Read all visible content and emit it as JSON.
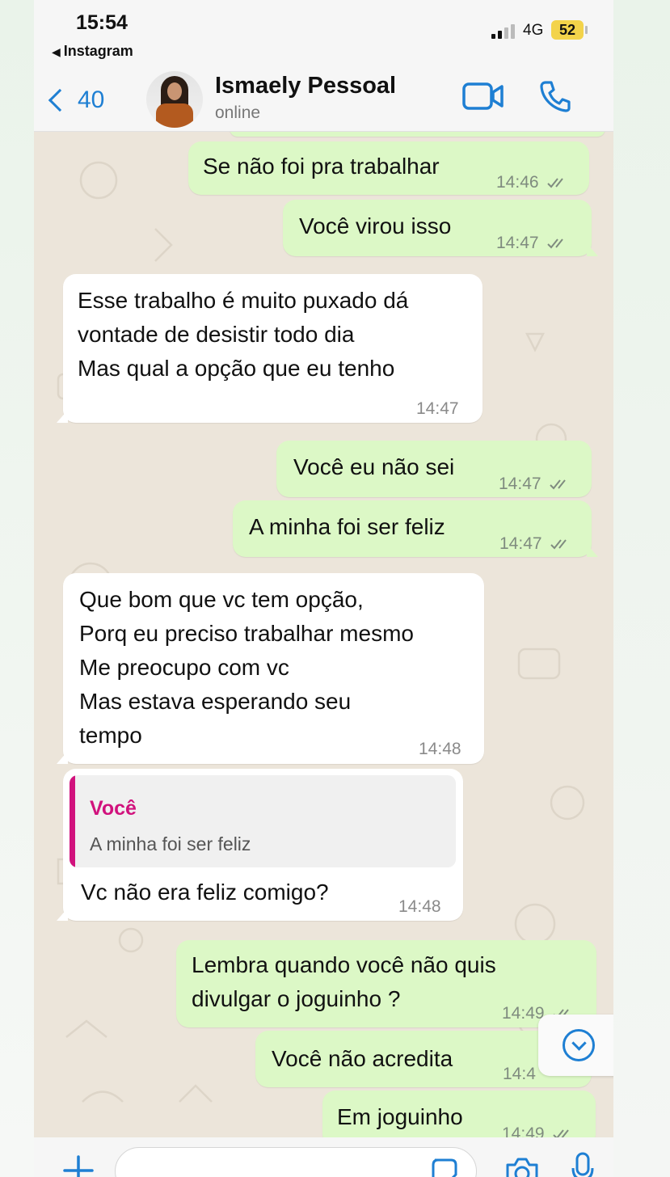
{
  "status_bar": {
    "time": "15:54",
    "back_app": "Instagram",
    "network": "4G",
    "battery": "52"
  },
  "header": {
    "back_count": "40",
    "contact_name": "Ismaely Pessoal",
    "contact_status": "online"
  },
  "messages": [
    {
      "dir": "out",
      "text": "Se não foi pra trabalhar",
      "time": "14:46",
      "read": true
    },
    {
      "dir": "out",
      "text": "Você virou isso",
      "time": "14:47",
      "read": true
    },
    {
      "dir": "in",
      "text": "Esse trabalho é muito puxado dá\nvontade de desistir todo dia\nMas qual a opção que eu tenho",
      "time": "14:47"
    },
    {
      "dir": "out",
      "text": "Você eu não sei",
      "time": "14:47",
      "read": true
    },
    {
      "dir": "out",
      "text": "A minha foi ser feliz",
      "time": "14:47",
      "read": true
    },
    {
      "dir": "in",
      "text": "Que bom que vc tem opção,\nPorq eu preciso trabalhar mesmo\nMe preocupo com vc\nMas estava esperando seu\ntempo",
      "time": "14:48"
    },
    {
      "dir": "in",
      "quote_author": "Você",
      "quote_text": "A minha foi ser feliz",
      "text": "Vc não era feliz comigo?",
      "time": "14:48"
    },
    {
      "dir": "out",
      "text": "Lembra quando você não quis\ndivulgar o joguinho ?",
      "time": "14:49",
      "read": true
    },
    {
      "dir": "out",
      "text": "Você não acredita",
      "time": "14:4",
      "read": true
    },
    {
      "dir": "out",
      "text": "Em joguinho",
      "time": "14:49",
      "read": true
    }
  ],
  "input": {
    "placeholder": ""
  },
  "colors": {
    "accent": "#1e7fd3",
    "outgoing": "#dcf8c6",
    "incoming": "#ffffff",
    "quote_author": "#d1127d",
    "chat_bg": "#ece5da"
  },
  "icons": [
    "video-camera-icon",
    "phone-icon",
    "chevron-down-icon",
    "plus-icon",
    "sticker-icon",
    "camera-icon",
    "microphone-icon"
  ]
}
